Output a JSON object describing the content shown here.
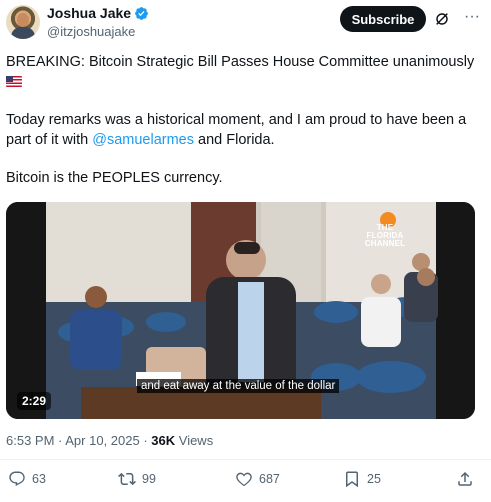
{
  "author": {
    "display_name": "Joshua Jake",
    "handle": "@itzjoshuajake",
    "verified": true
  },
  "header": {
    "subscribe_label": "Subscribe",
    "grok_icon": "grok-icon",
    "more_icon": "more-icon"
  },
  "tweet": {
    "line1": "BREAKING: Bitcoin Strategic Bill Passes House Committee unanimously",
    "flag_icon": "us-flag-icon",
    "line2_prefix": "Today remarks was a historical moment, and I am proud to have been a part of it with ",
    "mention": "@samuelarmes",
    "line2_suffix": " and Florida.",
    "line3": "Bitcoin is the PEOPLES currency."
  },
  "media": {
    "duration": "2:29",
    "caption": "and eat away at the value of the dollar",
    "channel_logo_line1": "THE",
    "channel_logo_line2": "FLORIDA",
    "channel_logo_line3": "CHANNEL"
  },
  "meta": {
    "time": "6:53 PM",
    "separator1": " · ",
    "date": "Apr 10, 2025",
    "separator2": " · ",
    "views_count": "36K",
    "views_label": " Views"
  },
  "actions": {
    "replies": "63",
    "reposts": "99",
    "likes": "687",
    "bookmarks": "25"
  },
  "colors": {
    "accent": "#1d9bf0",
    "text": "#0f1419",
    "muted": "#536471",
    "subscribe_bg": "#0f1419"
  }
}
